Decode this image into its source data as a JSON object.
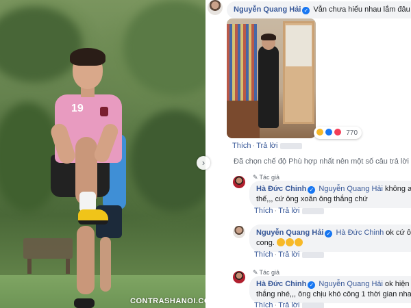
{
  "photo": {
    "watermark": "CONTRASHANOI.COM",
    "shirt_number": "19",
    "nav_icon": "chevron-right-icon"
  },
  "comments": {
    "top": {
      "author": "Nguyễn Quang Hải",
      "text": "Vẫn chưa hiểu nhau lắm đâu",
      "reaction_count": "770",
      "like_label": "Thích",
      "reply_label": "Trả lời"
    },
    "notice": "Đã chọn chế độ Phù hợp nhất nên một số câu trả lời",
    "replies": [
      {
        "author_badge": "Tác giả",
        "author": "Hà Đức Chinh",
        "mention": "Nguyễn Quang Hải",
        "text_line1": "không ae",
        "text_line2": "thế,,, cứ ông xoăn ông thắng chứ",
        "like_label": "Thích",
        "reply_label": "Trả lời"
      },
      {
        "author": "Nguyễn Quang Hải",
        "mention": "Hà Đức Chinh",
        "text_line1": "ok cứ ông",
        "text_line2": "cong.",
        "like_label": "Thích",
        "reply_label": "Trả lời"
      },
      {
        "author_badge": "Tác giả",
        "author": "Hà Đức Chinh",
        "mention": "Nguyễn Quang Hải",
        "text_line1": "ok hiện g",
        "text_line2": "thắng nhé,,, ông chịu khó công 1 thời gian nha",
        "like_label": "Thích",
        "reply_label": "Trả lời"
      }
    ]
  },
  "colors": {
    "link": "#385898",
    "bubble": "#f2f3f5",
    "verified": "#1877f2"
  }
}
